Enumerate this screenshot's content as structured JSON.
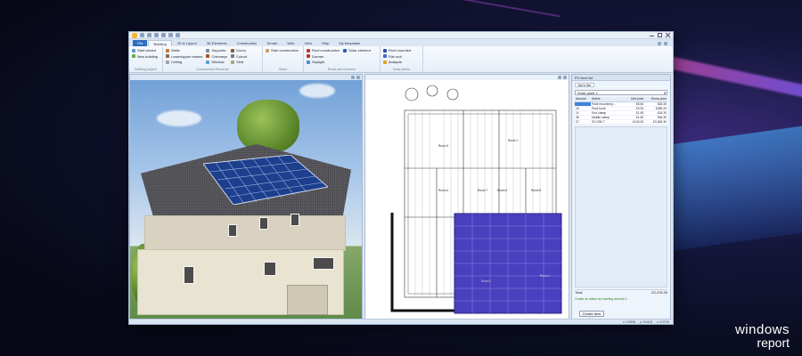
{
  "window": {
    "tabs": [
      {
        "label": "File"
      },
      {
        "label": "Building"
      },
      {
        "label": "2D & Layout"
      },
      {
        "label": "3D Elements"
      },
      {
        "label": "Construction"
      },
      {
        "label": "Terrain"
      },
      {
        "label": "Web"
      },
      {
        "label": "View"
      },
      {
        "label": "Help"
      },
      {
        "label": "My templates"
      }
    ]
  },
  "ribbon": {
    "groups": [
      {
        "label": "Building project",
        "items": [
          "Start wizard",
          "New building"
        ]
      },
      {
        "label": "Construction Elements",
        "items": [
          "Walls",
          "Lower/upper beams",
          "Ceiling",
          "Supports",
          "Chimneys",
          "Window",
          "Doors",
          "Cutout",
          "Skirt"
        ]
      },
      {
        "label": "Stairs",
        "items": [
          "Stair construction"
        ]
      },
      {
        "label": "Roofs and Dormers",
        "items": [
          "Roof construction",
          "Dormer",
          "Skylight",
          "Solar element"
        ]
      },
      {
        "label": "Solar plants",
        "items": [
          "Roof mounted",
          "Flat roof",
          "Analysis"
        ]
      }
    ]
  },
  "plan": {
    "rooms": [
      "Room 3",
      "Room 1",
      "Room 4",
      "Room 7",
      "Room 6",
      "Room 5",
      "Room 2",
      "Room 1"
    ]
  },
  "side_panel": {
    "title": "PV item list",
    "tab": "Item list",
    "select_value": "Solar plant 1",
    "columns": [
      "Amount",
      "Article",
      "Unit price",
      "Gross price"
    ],
    "rows": [
      {
        "amount": "",
        "article": "Roof mounted p...",
        "unit": "£5.60",
        "gross": "£48.30"
      },
      {
        "amount": "16",
        "article": "Roof hook",
        "unit": "£3.00",
        "gross": "£286.20"
      },
      {
        "amount": "11",
        "article": "End clamp",
        "unit": "£1.60",
        "gross": "£18.30"
      },
      {
        "amount": "35",
        "article": "Middle clamp",
        "unit": "£1.60",
        "gross": "£56.30"
      },
      {
        "amount": "27",
        "article": "SV-228-T",
        "unit": "£140.00",
        "gross": "£3,360.30"
      }
    ],
    "total_label": "Total",
    "total_value": "£3,478.30",
    "note": "Create an article by inserting amount 0.",
    "button_label": "Create item list"
  },
  "statusbar": {
    "values": [
      "x: 2.0905",
      "y: 3.0410",
      "z: 0.0710"
    ]
  },
  "brand": {
    "line1": "windows",
    "line2": "report"
  },
  "colors": {
    "accent": "#2f6fbd",
    "solar": "#4a3fbf",
    "selection": "#3b84d8"
  }
}
